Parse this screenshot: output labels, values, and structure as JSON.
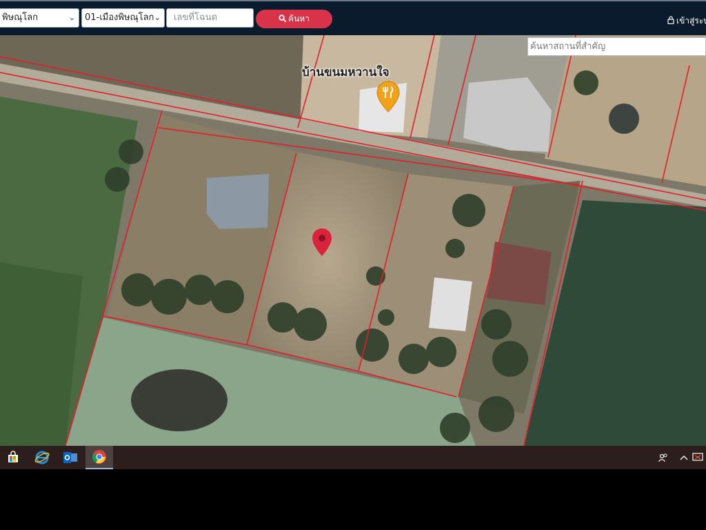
{
  "toolbar": {
    "province_value": "พิษณุโลก",
    "district_value": "01-เมืองพิษณุโลก",
    "deed_placeholder": "เลขที่โฉนด",
    "search_button": "ค้นหา",
    "login_link": "เข้าสู่ระบ"
  },
  "map": {
    "place_search_placeholder": "ค้นหาสถานที่สำคัญ",
    "poi_name": "บ้านขนมหวานใจ",
    "poi_icon": "restaurant-pin-icon",
    "parcel_marker_icon": "location-pin-icon",
    "parcel_line_color": "#e31e2b",
    "marker_color": "#d9233c",
    "poi_marker_color": "#f0a21a"
  },
  "taskbar": {
    "icons": [
      "windows-store-icon",
      "internet-explorer-icon",
      "outlook-icon",
      "chrome-icon"
    ],
    "tray_icons": [
      "people-icon",
      "chevron-up-icon",
      "notification-icon"
    ]
  }
}
